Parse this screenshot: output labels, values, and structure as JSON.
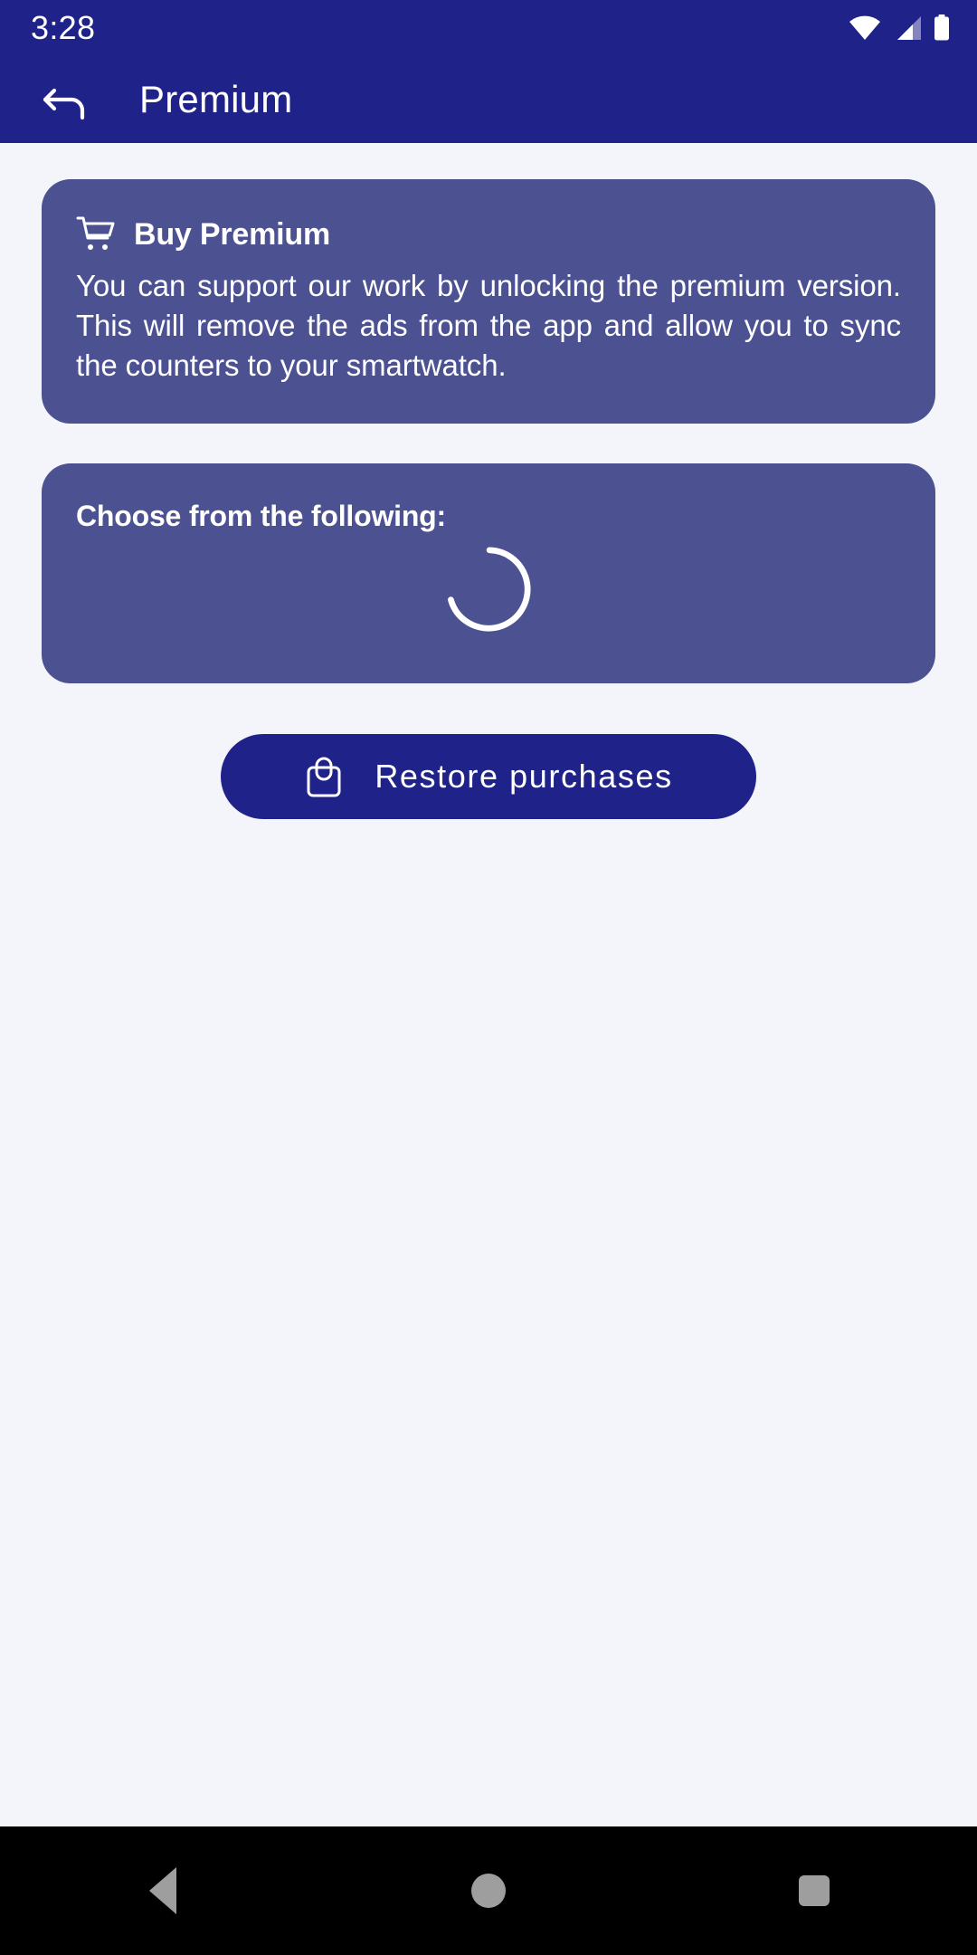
{
  "status_bar": {
    "time": "3:28",
    "icons": [
      "wifi-icon",
      "cell-signal-icon",
      "battery-icon"
    ]
  },
  "app_bar": {
    "back_icon": "back-arrow-icon",
    "title": "Premium"
  },
  "buy_premium_card": {
    "icon": "shopping-cart-icon",
    "title": "Buy Premium",
    "body": "You can support our work by unlocking the premium version. This will remove the ads from the app and allow you to sync the counters to your smartwatch."
  },
  "choose_card": {
    "title": "Choose from the following:",
    "loading_icon": "loading-spinner-icon"
  },
  "restore_button": {
    "icon": "shopping-bag-icon",
    "label": "Restore purchases"
  },
  "nav_bar": {
    "back": "nav-back-icon",
    "home": "nav-home-icon",
    "recents": "nav-recents-icon"
  },
  "colors": {
    "primary": "#1f2289",
    "card": "#4c5191",
    "background": "#f4f5fa",
    "on_primary": "#ffffff",
    "nav_bar": "#000000",
    "nav_icon": "#9e9e9e"
  }
}
